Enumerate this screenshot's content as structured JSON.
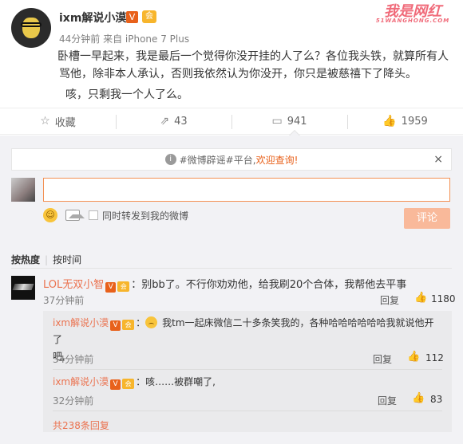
{
  "post": {
    "author": "ixm解说小漠",
    "verified_mark": "V",
    "member_mark": "会",
    "meta": "44分钟前 来自 iPhone 7 Plus",
    "watermark": "我是网红",
    "watermark_sub": "51WANGHONG.COM",
    "text_line1": "卧槽一早起来，我是最后一个觉得你没开挂的人了么？各位我头铁，就算所有人",
    "text_line2": "骂他，除非本人承认，否则我依然认为你没开，你只是被慈禧下了降头。",
    "text_line3": "咳，只剩我一个人了么。"
  },
  "actions": {
    "favorite": {
      "label": "收藏",
      "icon": "star-icon"
    },
    "repost": {
      "count": "43",
      "icon": "repost-icon"
    },
    "comment": {
      "count": "941",
      "icon": "comment-icon"
    },
    "like": {
      "count": "1959",
      "icon": "thumbs-up-icon"
    }
  },
  "notice": {
    "prefix": "#微博辟谣#平台,",
    "highlight": "欢迎查询!",
    "close": "×",
    "info_icon": "i"
  },
  "composer": {
    "repost_label": "同时转发到我的微博",
    "submit_label": "评论",
    "emoji_icon": "smiley-icon",
    "image_icon": "image-icon"
  },
  "sort": {
    "hot": "按热度",
    "time": "按时间"
  },
  "comments": [
    {
      "name": "LOL无双小智",
      "text": "：别bb了。不行你劝劝他，给我刷20个合体，我帮他去平事",
      "time": "37分钟前",
      "reply_label": "回复",
      "likes": "1180",
      "replies": [
        {
          "name": "ixm解说小漠",
          "text": "我tm一起床微信二十多条笑我的，各种哈哈哈哈哈哈我就说他开了",
          "text2": "吧,",
          "time": "34分钟前",
          "reply_label": "回复",
          "likes": "112"
        },
        {
          "name": "ixm解说小漠",
          "text": "：咳……被群嘲了,",
          "time": "32分钟前",
          "reply_label": "回复",
          "likes": "83"
        }
      ],
      "more_replies": "共238条回复"
    }
  ],
  "colors": {
    "accent": "#eb7350",
    "panel_bg": "#f2f2f5",
    "submit_disabled": "#f9b99a"
  }
}
